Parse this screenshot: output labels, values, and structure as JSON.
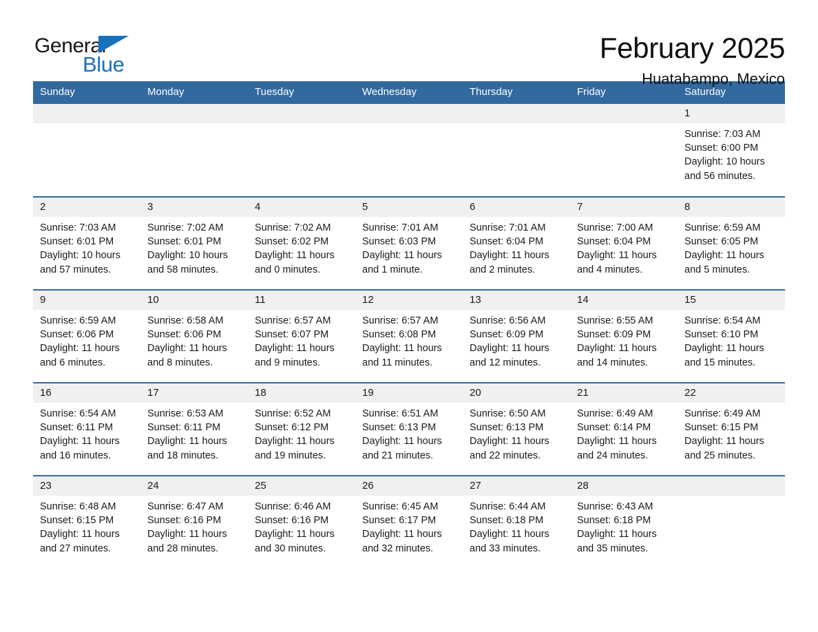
{
  "logo": {
    "word1": "General",
    "word2": "Blue",
    "triangle_color": "#1970ba",
    "text_color": "#14171a"
  },
  "header": {
    "month_title": "February 2025",
    "location": "Huatabampo, Mexico"
  },
  "theme": {
    "header_bar": "#32699f",
    "week_divider": "#32699f",
    "daynum_bg": "#f0f0f0",
    "cell_bg": "#ffffff",
    "text": "#1a1a1a"
  },
  "calendar": {
    "weekday_headers": [
      "Sunday",
      "Monday",
      "Tuesday",
      "Wednesday",
      "Thursday",
      "Friday",
      "Saturday"
    ],
    "weeks": [
      [
        {
          "day": "",
          "blank": true,
          "sunrise": "",
          "sunset": "",
          "daylight1": "",
          "daylight2": ""
        },
        {
          "day": "",
          "blank": true,
          "sunrise": "",
          "sunset": "",
          "daylight1": "",
          "daylight2": ""
        },
        {
          "day": "",
          "blank": true,
          "sunrise": "",
          "sunset": "",
          "daylight1": "",
          "daylight2": ""
        },
        {
          "day": "",
          "blank": true,
          "sunrise": "",
          "sunset": "",
          "daylight1": "",
          "daylight2": ""
        },
        {
          "day": "",
          "blank": true,
          "sunrise": "",
          "sunset": "",
          "daylight1": "",
          "daylight2": ""
        },
        {
          "day": "",
          "blank": true,
          "sunrise": "",
          "sunset": "",
          "daylight1": "",
          "daylight2": ""
        },
        {
          "day": "1",
          "blank": false,
          "sunrise": "Sunrise: 7:03 AM",
          "sunset": "Sunset: 6:00 PM",
          "daylight1": "Daylight: 10 hours",
          "daylight2": "and 56 minutes."
        }
      ],
      [
        {
          "day": "2",
          "blank": false,
          "sunrise": "Sunrise: 7:03 AM",
          "sunset": "Sunset: 6:01 PM",
          "daylight1": "Daylight: 10 hours",
          "daylight2": "and 57 minutes."
        },
        {
          "day": "3",
          "blank": false,
          "sunrise": "Sunrise: 7:02 AM",
          "sunset": "Sunset: 6:01 PM",
          "daylight1": "Daylight: 10 hours",
          "daylight2": "and 58 minutes."
        },
        {
          "day": "4",
          "blank": false,
          "sunrise": "Sunrise: 7:02 AM",
          "sunset": "Sunset: 6:02 PM",
          "daylight1": "Daylight: 11 hours",
          "daylight2": "and 0 minutes."
        },
        {
          "day": "5",
          "blank": false,
          "sunrise": "Sunrise: 7:01 AM",
          "sunset": "Sunset: 6:03 PM",
          "daylight1": "Daylight: 11 hours",
          "daylight2": "and 1 minute."
        },
        {
          "day": "6",
          "blank": false,
          "sunrise": "Sunrise: 7:01 AM",
          "sunset": "Sunset: 6:04 PM",
          "daylight1": "Daylight: 11 hours",
          "daylight2": "and 2 minutes."
        },
        {
          "day": "7",
          "blank": false,
          "sunrise": "Sunrise: 7:00 AM",
          "sunset": "Sunset: 6:04 PM",
          "daylight1": "Daylight: 11 hours",
          "daylight2": "and 4 minutes."
        },
        {
          "day": "8",
          "blank": false,
          "sunrise": "Sunrise: 6:59 AM",
          "sunset": "Sunset: 6:05 PM",
          "daylight1": "Daylight: 11 hours",
          "daylight2": "and 5 minutes."
        }
      ],
      [
        {
          "day": "9",
          "blank": false,
          "sunrise": "Sunrise: 6:59 AM",
          "sunset": "Sunset: 6:06 PM",
          "daylight1": "Daylight: 11 hours",
          "daylight2": "and 6 minutes."
        },
        {
          "day": "10",
          "blank": false,
          "sunrise": "Sunrise: 6:58 AM",
          "sunset": "Sunset: 6:06 PM",
          "daylight1": "Daylight: 11 hours",
          "daylight2": "and 8 minutes."
        },
        {
          "day": "11",
          "blank": false,
          "sunrise": "Sunrise: 6:57 AM",
          "sunset": "Sunset: 6:07 PM",
          "daylight1": "Daylight: 11 hours",
          "daylight2": "and 9 minutes."
        },
        {
          "day": "12",
          "blank": false,
          "sunrise": "Sunrise: 6:57 AM",
          "sunset": "Sunset: 6:08 PM",
          "daylight1": "Daylight: 11 hours",
          "daylight2": "and 11 minutes."
        },
        {
          "day": "13",
          "blank": false,
          "sunrise": "Sunrise: 6:56 AM",
          "sunset": "Sunset: 6:09 PM",
          "daylight1": "Daylight: 11 hours",
          "daylight2": "and 12 minutes."
        },
        {
          "day": "14",
          "blank": false,
          "sunrise": "Sunrise: 6:55 AM",
          "sunset": "Sunset: 6:09 PM",
          "daylight1": "Daylight: 11 hours",
          "daylight2": "and 14 minutes."
        },
        {
          "day": "15",
          "blank": false,
          "sunrise": "Sunrise: 6:54 AM",
          "sunset": "Sunset: 6:10 PM",
          "daylight1": "Daylight: 11 hours",
          "daylight2": "and 15 minutes."
        }
      ],
      [
        {
          "day": "16",
          "blank": false,
          "sunrise": "Sunrise: 6:54 AM",
          "sunset": "Sunset: 6:11 PM",
          "daylight1": "Daylight: 11 hours",
          "daylight2": "and 16 minutes."
        },
        {
          "day": "17",
          "blank": false,
          "sunrise": "Sunrise: 6:53 AM",
          "sunset": "Sunset: 6:11 PM",
          "daylight1": "Daylight: 11 hours",
          "daylight2": "and 18 minutes."
        },
        {
          "day": "18",
          "blank": false,
          "sunrise": "Sunrise: 6:52 AM",
          "sunset": "Sunset: 6:12 PM",
          "daylight1": "Daylight: 11 hours",
          "daylight2": "and 19 minutes."
        },
        {
          "day": "19",
          "blank": false,
          "sunrise": "Sunrise: 6:51 AM",
          "sunset": "Sunset: 6:13 PM",
          "daylight1": "Daylight: 11 hours",
          "daylight2": "and 21 minutes."
        },
        {
          "day": "20",
          "blank": false,
          "sunrise": "Sunrise: 6:50 AM",
          "sunset": "Sunset: 6:13 PM",
          "daylight1": "Daylight: 11 hours",
          "daylight2": "and 22 minutes."
        },
        {
          "day": "21",
          "blank": false,
          "sunrise": "Sunrise: 6:49 AM",
          "sunset": "Sunset: 6:14 PM",
          "daylight1": "Daylight: 11 hours",
          "daylight2": "and 24 minutes."
        },
        {
          "day": "22",
          "blank": false,
          "sunrise": "Sunrise: 6:49 AM",
          "sunset": "Sunset: 6:15 PM",
          "daylight1": "Daylight: 11 hours",
          "daylight2": "and 25 minutes."
        }
      ],
      [
        {
          "day": "23",
          "blank": false,
          "sunrise": "Sunrise: 6:48 AM",
          "sunset": "Sunset: 6:15 PM",
          "daylight1": "Daylight: 11 hours",
          "daylight2": "and 27 minutes."
        },
        {
          "day": "24",
          "blank": false,
          "sunrise": "Sunrise: 6:47 AM",
          "sunset": "Sunset: 6:16 PM",
          "daylight1": "Daylight: 11 hours",
          "daylight2": "and 28 minutes."
        },
        {
          "day": "25",
          "blank": false,
          "sunrise": "Sunrise: 6:46 AM",
          "sunset": "Sunset: 6:16 PM",
          "daylight1": "Daylight: 11 hours",
          "daylight2": "and 30 minutes."
        },
        {
          "day": "26",
          "blank": false,
          "sunrise": "Sunrise: 6:45 AM",
          "sunset": "Sunset: 6:17 PM",
          "daylight1": "Daylight: 11 hours",
          "daylight2": "and 32 minutes."
        },
        {
          "day": "27",
          "blank": false,
          "sunrise": "Sunrise: 6:44 AM",
          "sunset": "Sunset: 6:18 PM",
          "daylight1": "Daylight: 11 hours",
          "daylight2": "and 33 minutes."
        },
        {
          "day": "28",
          "blank": false,
          "sunrise": "Sunrise: 6:43 AM",
          "sunset": "Sunset: 6:18 PM",
          "daylight1": "Daylight: 11 hours",
          "daylight2": "and 35 minutes."
        },
        {
          "day": "",
          "blank": true,
          "sunrise": "",
          "sunset": "",
          "daylight1": "",
          "daylight2": ""
        }
      ]
    ]
  }
}
